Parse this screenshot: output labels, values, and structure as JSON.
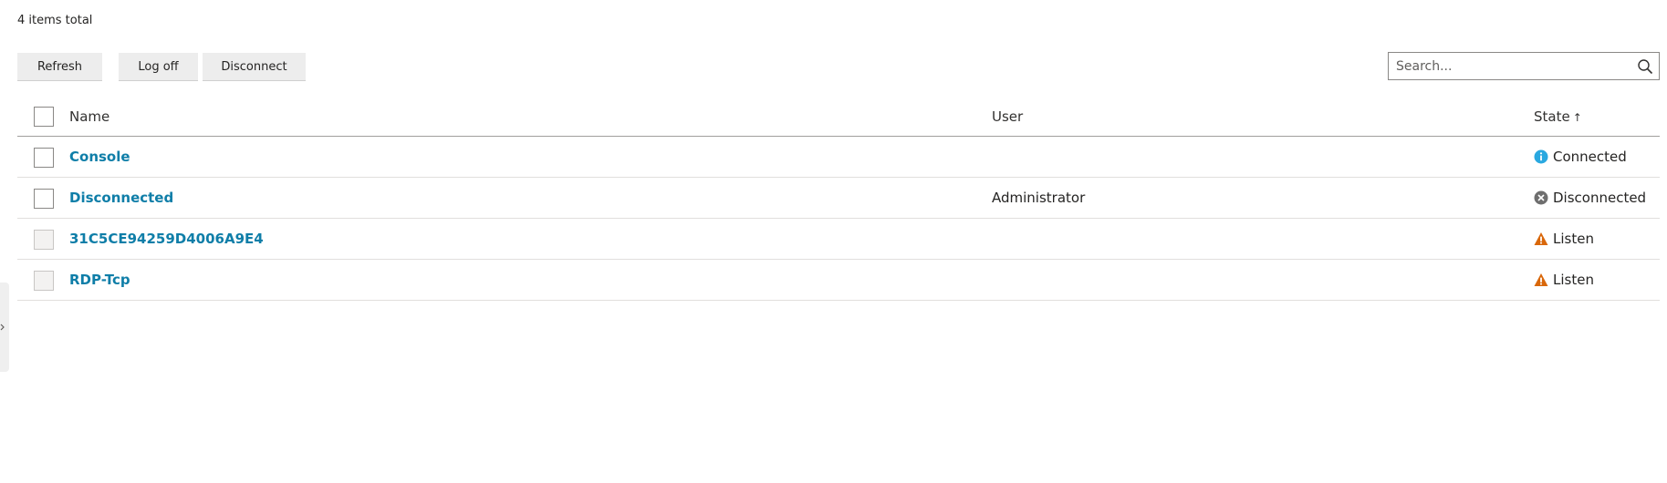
{
  "summary": {
    "count_text": "4 items total"
  },
  "toolbar": {
    "refresh_label": "Refresh",
    "logoff_label": "Log off",
    "disconnect_label": "Disconnect"
  },
  "search": {
    "placeholder": "Search...",
    "value": ""
  },
  "table": {
    "columns": {
      "name": "Name",
      "user": "User",
      "state": "State",
      "state_sort": "↑"
    },
    "rows": [
      {
        "name": "Console",
        "user": "",
        "state": "Connected",
        "state_icon": "info-icon",
        "checkbox_enabled": true
      },
      {
        "name": "Disconnected",
        "user": "Administrator",
        "state": "Disconnected",
        "state_icon": "error-circle-icon",
        "checkbox_enabled": true
      },
      {
        "name": "31C5CE94259D4006A9E4",
        "user": "",
        "state": "Listen",
        "state_icon": "warning-icon",
        "checkbox_enabled": false
      },
      {
        "name": "RDP-Tcp",
        "user": "",
        "state": "Listen",
        "state_icon": "warning-icon",
        "checkbox_enabled": false
      }
    ]
  },
  "colors": {
    "link": "#0f7ea8",
    "info": "#29a8e0",
    "error": "#6e6e6e",
    "warning": "#d9670a"
  }
}
